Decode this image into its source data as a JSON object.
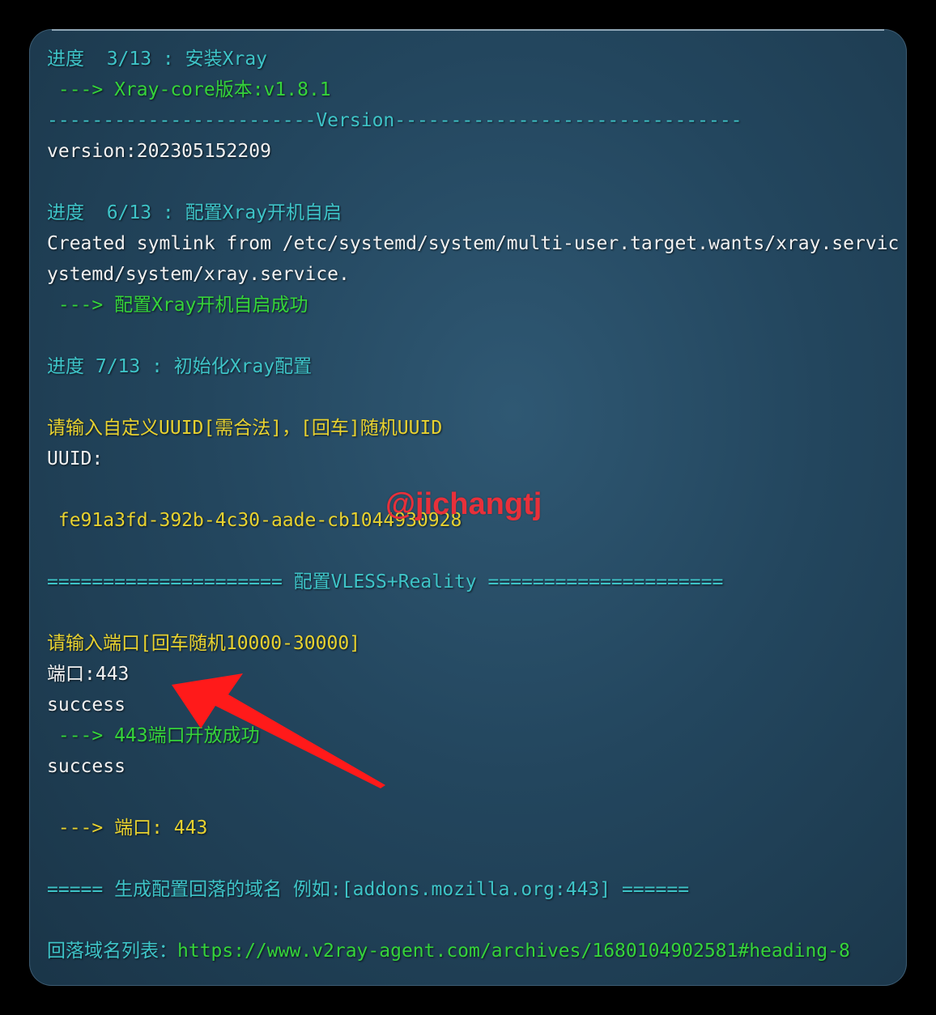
{
  "terminal": {
    "lines": [
      {
        "text": "进度  3/13 : 安装Xray",
        "color": "#3ec4c8"
      },
      {
        "text": " ---> Xray-core版本:v1.8.1",
        "color": "#35d43a"
      },
      {
        "text": "------------------------Version-------------------------------",
        "color": "#3ec4c8"
      },
      {
        "text": "version:202305152209",
        "color": "#f2f2f2"
      },
      {
        "text": "",
        "color": "#f2f2f2"
      },
      {
        "text": "进度  6/13 : 配置Xray开机自启",
        "color": "#3ec4c8"
      },
      {
        "text": "Created symlink from /etc/systemd/system/multi-user.target.wants/xray.servic",
        "color": "#f2f2f2"
      },
      {
        "text": "ystemd/system/xray.service.",
        "color": "#f2f2f2"
      },
      {
        "text": " ---> 配置Xray开机自启成功",
        "color": "#35d43a"
      },
      {
        "text": "",
        "color": "#f2f2f2"
      },
      {
        "text": "进度 7/13 : 初始化Xray配置",
        "color": "#3ec4c8"
      },
      {
        "text": "",
        "color": "#f2f2f2"
      },
      {
        "text": "请输入自定义UUID[需合法]，[回车]随机UUID",
        "color": "#e8d230"
      },
      {
        "text": "UUID:",
        "color": "#f2f2f2"
      },
      {
        "text": "",
        "color": "#f2f2f2"
      },
      {
        "text": " fe91a3fd-392b-4c30-aade-cb1044930928",
        "color": "#e8d230"
      },
      {
        "text": "",
        "color": "#f2f2f2"
      },
      {
        "text": "===================== 配置VLESS+Reality =====================",
        "color": "#3ec4c8"
      },
      {
        "text": "",
        "color": "#f2f2f2"
      },
      {
        "text": "请输入端口[回车随机10000-30000]",
        "color": "#e8d230"
      },
      {
        "text": "端口:443",
        "color": "#f2f2f2"
      },
      {
        "text": "success",
        "color": "#f2f2f2"
      },
      {
        "text": " ---> 443端口开放成功",
        "color": "#35d43a"
      },
      {
        "text": "success",
        "color": "#f2f2f2"
      },
      {
        "text": "",
        "color": "#f2f2f2"
      },
      {
        "text": " ---> 端口: 443",
        "color": "#e8d230"
      },
      {
        "text": "",
        "color": "#f2f2f2"
      },
      {
        "text": "===== 生成配置回落的域名 例如:[addons.mozilla.org:443] ======",
        "color": "#3ec4c8"
      },
      {
        "text": "",
        "color": "#f2f2f2"
      }
    ],
    "last_line": {
      "label": "回落域名列表：",
      "label_color": "#3ec4c8",
      "url": "https://www.v2ray-agent.com/archives/1680104902581#heading-8",
      "url_color": "#35d43a"
    }
  },
  "watermark": {
    "text": "@jichangtj",
    "color": "#e8303a"
  },
  "annotation": {
    "icon": "red-arrow-icon",
    "color": "#ff1a1a"
  }
}
